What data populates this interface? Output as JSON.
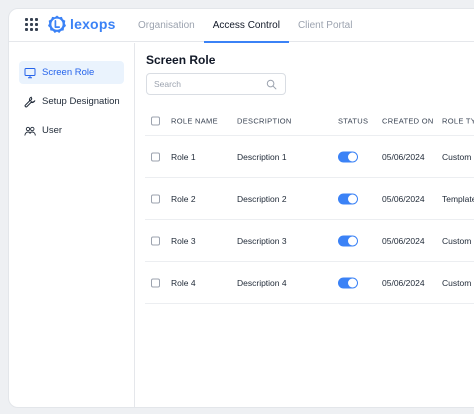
{
  "app": {
    "logo_text": "lexops"
  },
  "tabs": [
    {
      "label": "Organisation",
      "active": false
    },
    {
      "label": "Access Control",
      "active": true
    },
    {
      "label": "Client Portal",
      "active": false
    }
  ],
  "sidebar": {
    "items": [
      {
        "label": "Screen Role",
        "icon": "monitor-icon",
        "active": true
      },
      {
        "label": "Setup Designation",
        "icon": "wrench-icon",
        "active": false
      },
      {
        "label": "User",
        "icon": "users-icon",
        "active": false
      }
    ]
  },
  "main": {
    "title": "Screen Role",
    "search": {
      "placeholder": "Search",
      "value": ""
    }
  },
  "table": {
    "columns": [
      "ROLE NAME",
      "DESCRIPTION",
      "STATUS",
      "CREATED ON",
      "ROLE TYPE"
    ],
    "rows": [
      {
        "role_name": "Role 1",
        "description": "Description 1",
        "status_on": true,
        "created_on": "05/06/2024",
        "role_type": "Custom"
      },
      {
        "role_name": "Role 2",
        "description": "Description 2",
        "status_on": true,
        "created_on": "05/06/2024",
        "role_type": "Template"
      },
      {
        "role_name": "Role 3",
        "description": "Description 3",
        "status_on": true,
        "created_on": "05/06/2024",
        "role_type": "Custom"
      },
      {
        "role_name": "Role 4",
        "description": "Description 4",
        "status_on": true,
        "created_on": "05/06/2024",
        "role_type": "Custom"
      }
    ]
  },
  "colors": {
    "accent": "#3b82f6",
    "active_bg": "#eaf3fd",
    "border": "#e5e7eb"
  }
}
